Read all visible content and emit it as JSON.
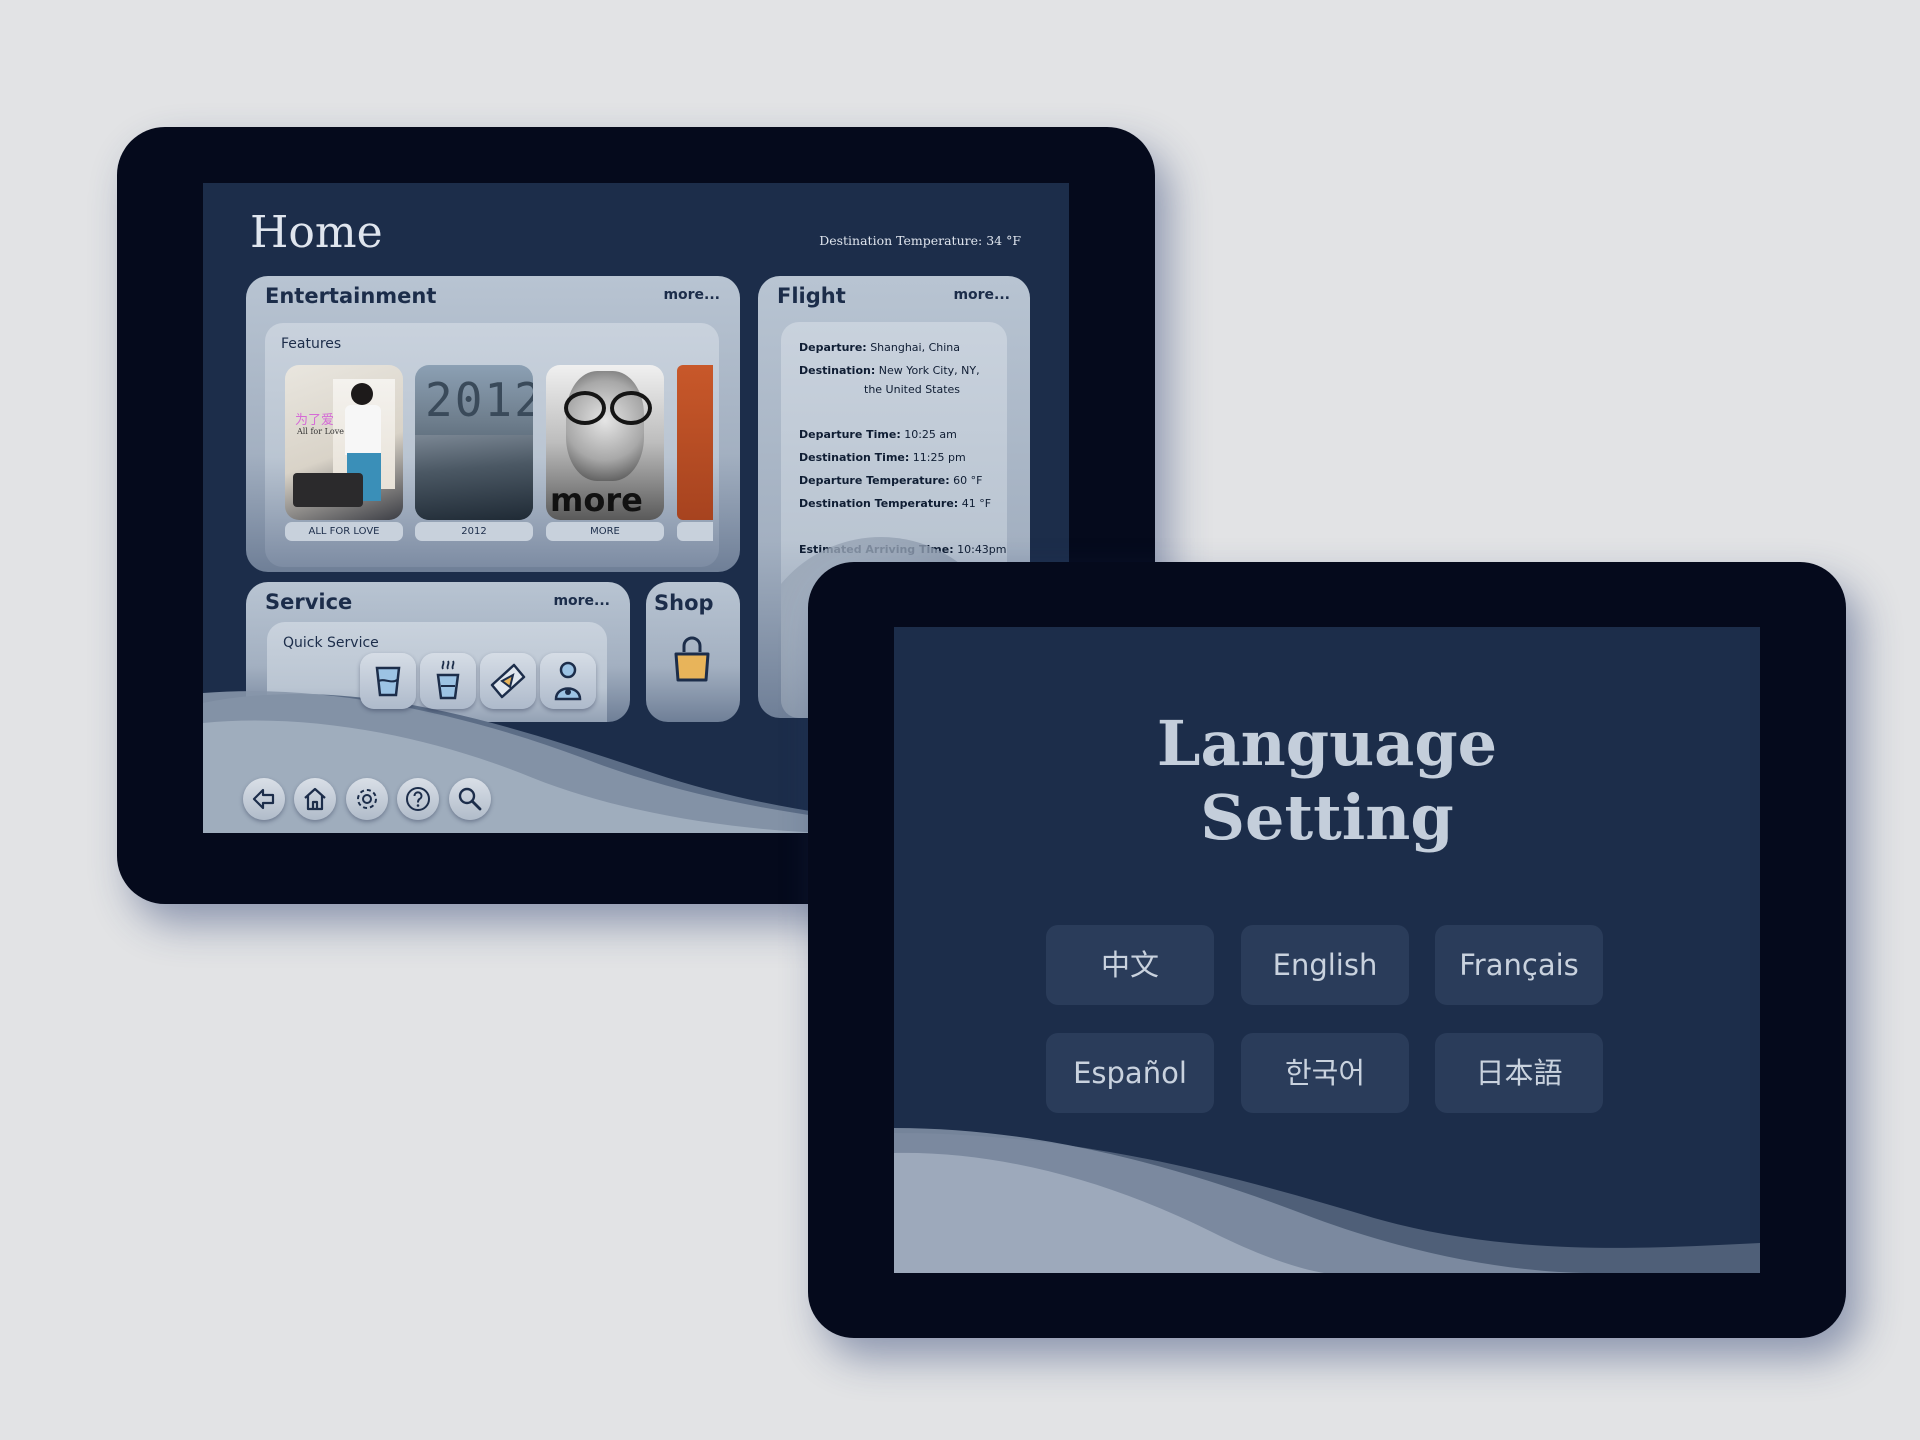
{
  "home": {
    "title": "Home",
    "destination_temperature": "Destination Temperature: 34 °F",
    "entertainment": {
      "title": "Entertainment",
      "more": "more...",
      "features_label": "Features",
      "posters": [
        {
          "caption": "ALL FOR LOVE",
          "art_text_cn": "为了爱",
          "art_text_en": "All for Love"
        },
        {
          "caption": "2012",
          "art_text": "2012"
        },
        {
          "caption": "MORE",
          "art_text": "more"
        },
        {
          "caption": ""
        }
      ]
    },
    "flight": {
      "title": "Flight",
      "more": "more...",
      "departure_label": "Departure:",
      "departure_value": "Shanghai, China",
      "destination_label": "Destination:",
      "destination_value_1": "New York City, NY,",
      "destination_value_2": "the United States",
      "departure_time_label": "Departure Time:",
      "departure_time_value": "10:25 am",
      "destination_time_label": "Destination Time:",
      "destination_time_value": "11:25 pm",
      "departure_temp_label": "Departure Temperature:",
      "departure_temp_value": "60 °F",
      "destination_temp_label": "Destination Temperature:",
      "destination_temp_value": "41 °F",
      "eta_label": "Estimated Arriving Time:",
      "eta_value": "10:43pm"
    },
    "service": {
      "title": "Service",
      "more": "more...",
      "quick_label": "Quick Service",
      "icons": [
        "water-glass-icon",
        "hot-drink-icon",
        "snack-icon",
        "attendant-icon"
      ]
    },
    "shop": {
      "title": "Shop",
      "icon": "shopping-bag-icon",
      "bag_color": "#e8b45a"
    },
    "nav": [
      "back-icon",
      "home-icon",
      "gear-icon",
      "help-icon",
      "search-icon"
    ]
  },
  "language": {
    "title_line1": "Language",
    "title_line2": "Setting",
    "options": [
      "中文",
      "English",
      "Français",
      "Español",
      "한국어",
      "日本語"
    ]
  },
  "colors": {
    "bezel": "#050a1c",
    "screen": "#1c2d4a",
    "card": "#b8c4d2",
    "text_light": "#dfe5ee"
  }
}
